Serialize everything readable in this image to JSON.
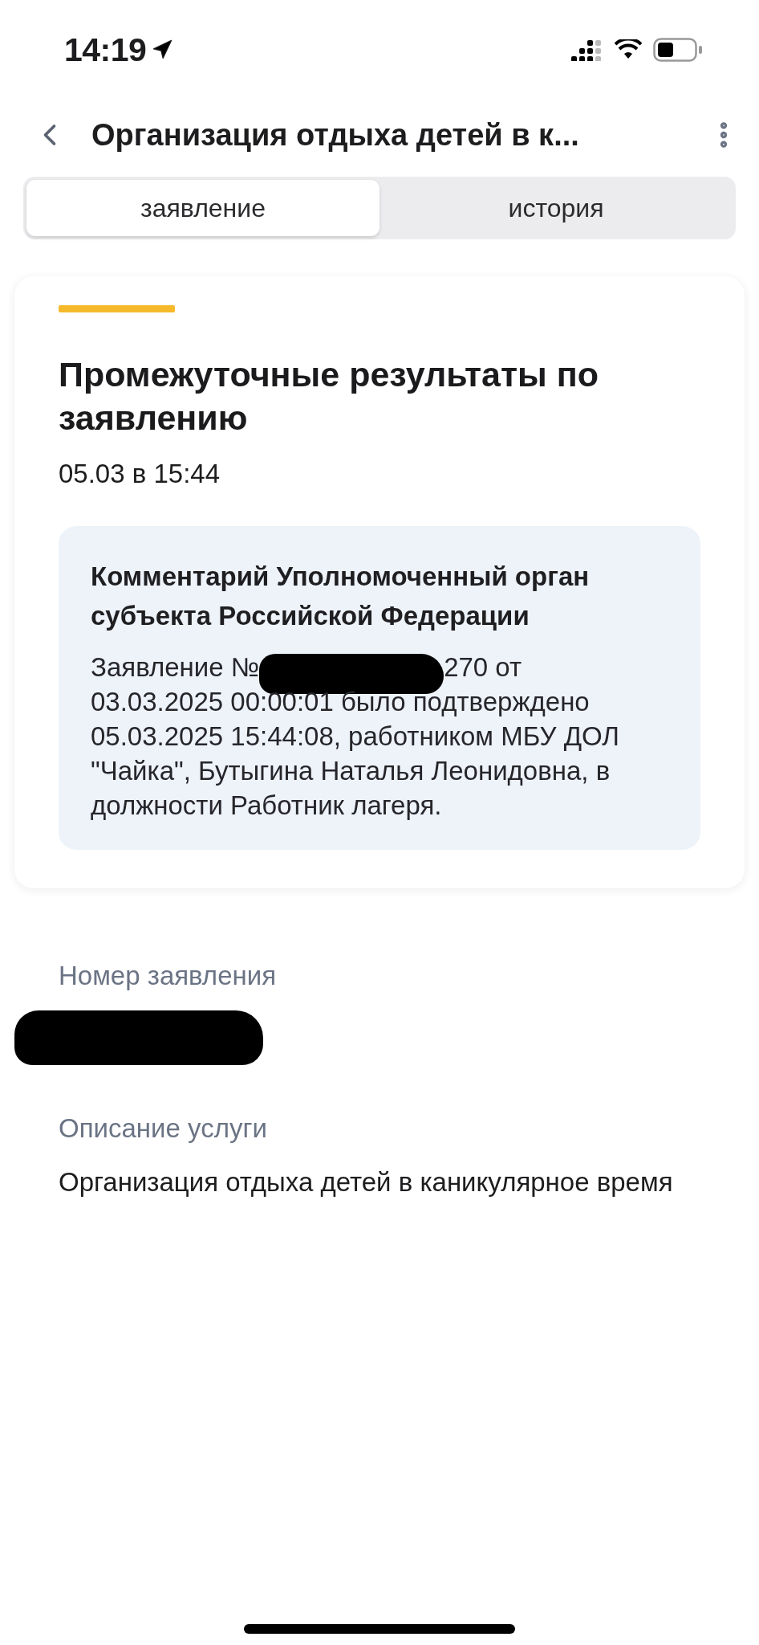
{
  "status_bar": {
    "time": "14:19"
  },
  "header": {
    "title": "Организация отдыха детей в к..."
  },
  "tabs": [
    {
      "label": "заявление",
      "selected": true
    },
    {
      "label": "история",
      "selected": false
    }
  ],
  "result_card": {
    "title": "Промежуточные результаты по заявлению",
    "date": "05.03 в 15:44",
    "comment": {
      "title": "Комментарий Уполномоченный орган субъекта Российской Федерации",
      "text_before": "Заявление №",
      "text_after": "270 от",
      "text_rest": "03.03.2025 00:00:01 было подтверждено 05.03.2025 15:44:08, работником МБУ ДОЛ \"Чайка\", Бутыгина Наталья Леонидовна, в должности Работник лагеря."
    }
  },
  "fields": [
    {
      "label": "Номер заявления",
      "kind": "redacted"
    },
    {
      "label": "Описание услуги",
      "kind": "text",
      "value": "Организация отдыха детей в каникулярное время"
    }
  ]
}
